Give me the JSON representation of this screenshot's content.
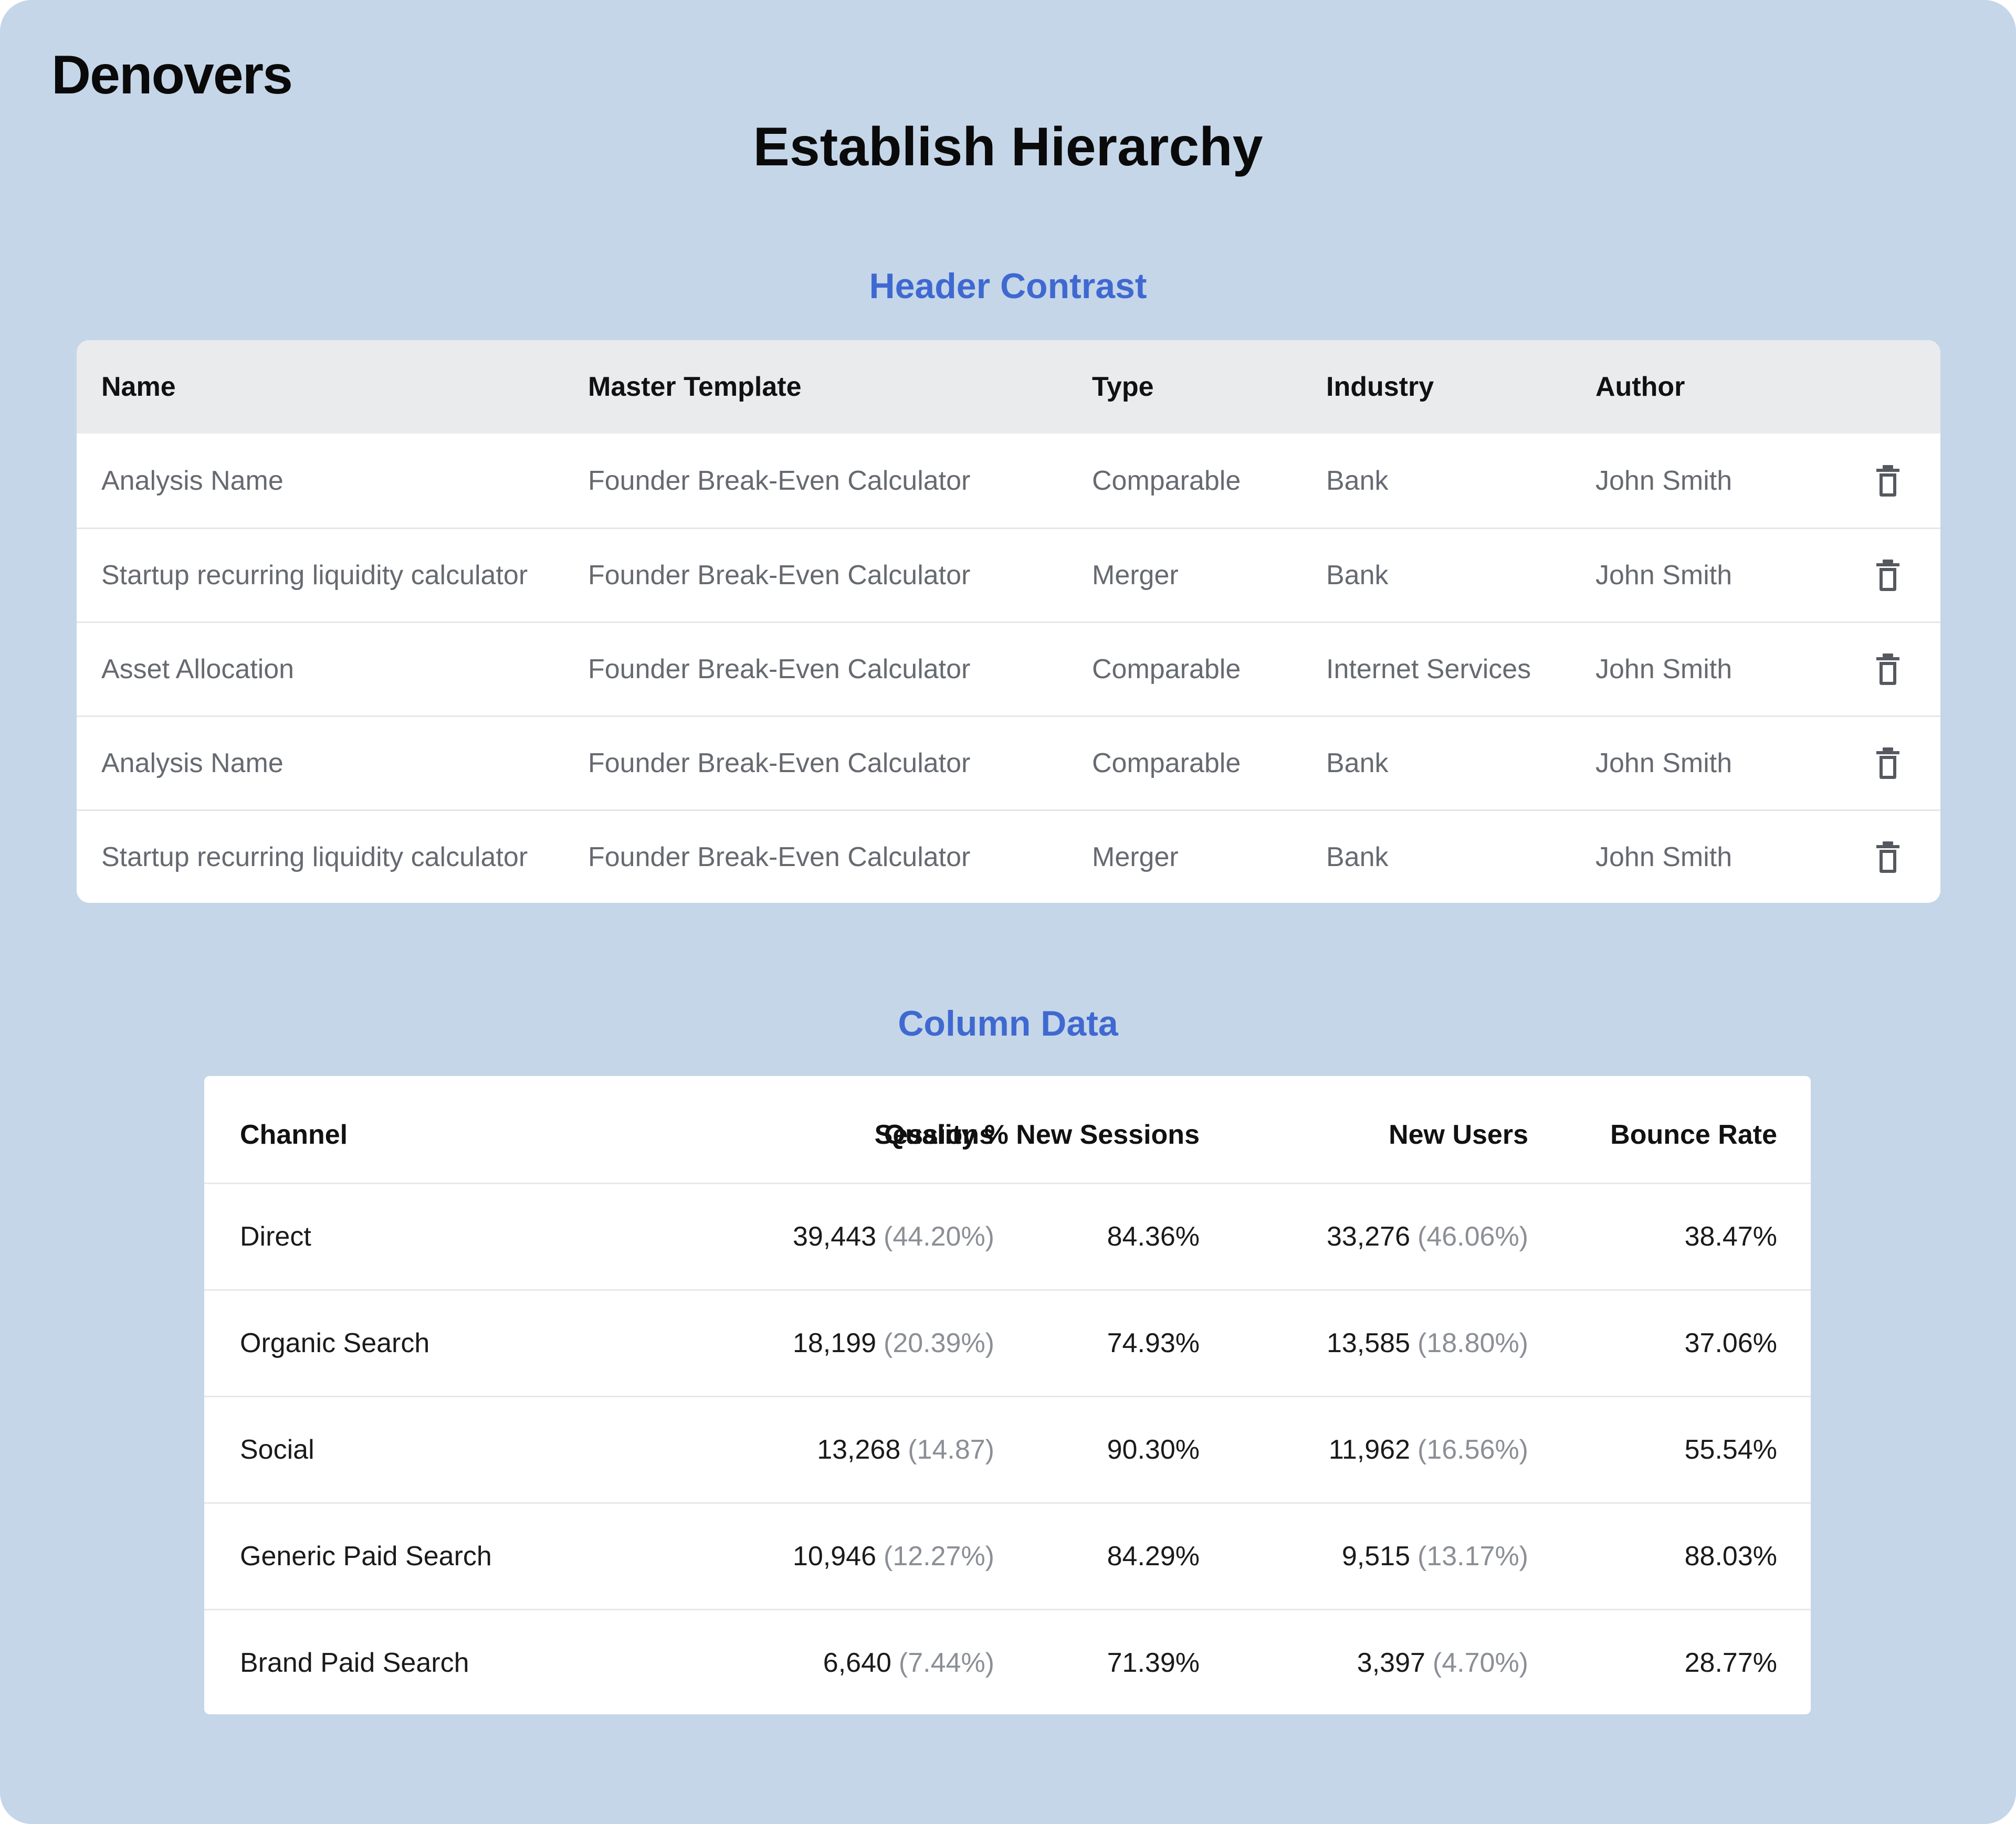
{
  "brand": "Denovers",
  "title": "Establish Hierarchy",
  "section1": {
    "title": "Header Contrast",
    "headers": {
      "name": "Name",
      "template": "Master Template",
      "type": "Type",
      "industry": "Industry",
      "author": "Author"
    },
    "rows": [
      {
        "name": "Analysis Name",
        "template": "Founder Break-Even Calculator",
        "type": "Comparable",
        "industry": "Bank",
        "author": "John Smith"
      },
      {
        "name": "Startup recurring liquidity calculator",
        "template": "Founder Break-Even Calculator",
        "type": "Merger",
        "industry": "Bank",
        "author": "John Smith"
      },
      {
        "name": "Asset Allocation",
        "template": "Founder Break-Even Calculator",
        "type": "Comparable",
        "industry": "Internet Services",
        "author": "John Smith"
      },
      {
        "name": "Analysis Name",
        "template": "Founder Break-Even Calculator",
        "type": "Comparable",
        "industry": "Bank",
        "author": "John Smith"
      },
      {
        "name": "Startup recurring liquidity calculator",
        "template": "Founder Break-Even Calculator",
        "type": "Merger",
        "industry": "Bank",
        "author": "John Smith"
      }
    ],
    "row_icon": "trash-icon"
  },
  "section2": {
    "title": "Column Data",
    "headers": {
      "channel": "Channel",
      "sessions": "Sessions",
      "quality": "Quality % New Sessions",
      "new_users": "New Users",
      "bounce": "Bounce Rate"
    },
    "rows": [
      {
        "channel": "Direct",
        "sessions": "39,443",
        "sessions_pct": "(44.20%)",
        "quality": "84.36%",
        "new_users": "33,276",
        "new_users_pct": "(46.06%)",
        "bounce": "38.47%"
      },
      {
        "channel": "Organic Search",
        "sessions": "18,199",
        "sessions_pct": "(20.39%)",
        "quality": "74.93%",
        "new_users": "13,585",
        "new_users_pct": "(18.80%)",
        "bounce": "37.06%"
      },
      {
        "channel": "Social",
        "sessions": "13,268",
        "sessions_pct": "(14.87)",
        "quality": "90.30%",
        "new_users": "11,962",
        "new_users_pct": "(16.56%)",
        "bounce": "55.54%"
      },
      {
        "channel": "Generic Paid Search",
        "sessions": "10,946",
        "sessions_pct": "(12.27%)",
        "quality": "84.29%",
        "new_users": "9,515",
        "new_users_pct": "(13.17%)",
        "bounce": "88.03%"
      },
      {
        "channel": "Brand Paid Search",
        "sessions": "6,640",
        "sessions_pct": "(7.44%)",
        "quality": "71.39%",
        "new_users": "3,397",
        "new_users_pct": "(4.70%)",
        "bounce": "28.77%"
      }
    ]
  },
  "colors": {
    "background": "#c5d6e8",
    "accent": "#3f69d1",
    "header_bg": "#eaebed",
    "muted_text": "#8b8f95"
  }
}
